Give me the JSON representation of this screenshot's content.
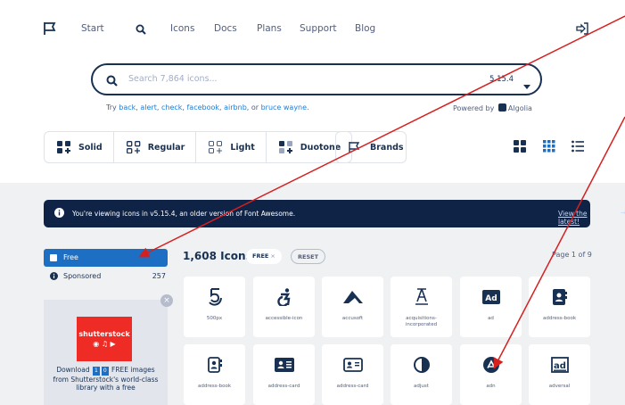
{
  "nav": {
    "items": [
      "Start",
      "Icons",
      "Docs",
      "Plans",
      "Support",
      "Blog"
    ]
  },
  "search": {
    "placeholder": "Search 7,864 icons...",
    "version": "5.15.4",
    "hint_prefix": "Try ",
    "hint_links": [
      "back",
      "alert",
      "check",
      "facebook",
      "airbnb",
      "bruce wayne"
    ],
    "hint_or": ", or ",
    "hint_suffix": ".",
    "powered_prefix": "Powered by",
    "powered_name": "Algolia"
  },
  "styles": [
    {
      "label": "Solid",
      "icon": "solid-style-icon"
    },
    {
      "label": "Regular",
      "icon": "regular-style-icon"
    },
    {
      "label": "Light",
      "icon": "light-style-icon"
    },
    {
      "label": "Duotone",
      "icon": "duotone-style-icon"
    }
  ],
  "brands_label": "Brands",
  "banner": {
    "message": "You're viewing icons in v5.15.4, an older version of Font Awesome.",
    "link": "View the latest!",
    "arrow": "→"
  },
  "sidebar": {
    "free_label": "Free",
    "sponsored_label": "Sponsored",
    "sponsored_count": "257"
  },
  "ad": {
    "brand": "shutterstock",
    "text_1": "Download",
    "digits": [
      "1",
      "0"
    ],
    "text_2": "FREE images from Shutterstock's world-class library with a free"
  },
  "results": {
    "count": "1,608 Icons",
    "free_pill": "FREE",
    "free_pill_x": "×",
    "reset_pill": "RESET",
    "page": "Page 1 of 9"
  },
  "icons": [
    {
      "name": "500px",
      "icon": "500px-icon"
    },
    {
      "name": "accessible-icon",
      "icon": "accessible-icon"
    },
    {
      "name": "accusoft",
      "icon": "accusoft-icon"
    },
    {
      "name": "acquisitions-incorporated",
      "icon": "acquisitions-incorporated-icon"
    },
    {
      "name": "ad",
      "icon": "ad-icon"
    },
    {
      "name": "address-book",
      "icon": "address-book-icon"
    },
    {
      "name": "address-book",
      "icon": "address-book-outline-icon"
    },
    {
      "name": "address-card",
      "icon": "address-card-icon"
    },
    {
      "name": "address-card",
      "icon": "address-card-outline-icon"
    },
    {
      "name": "adjust",
      "icon": "adjust-icon"
    },
    {
      "name": "adn",
      "icon": "adn-icon"
    },
    {
      "name": "adversal",
      "icon": "adversal-icon"
    }
  ],
  "colors": {
    "navy": "#183153",
    "blue": "#1c6fc2",
    "annotation_red": "#d62020",
    "banner_bg": "#0f2347"
  }
}
